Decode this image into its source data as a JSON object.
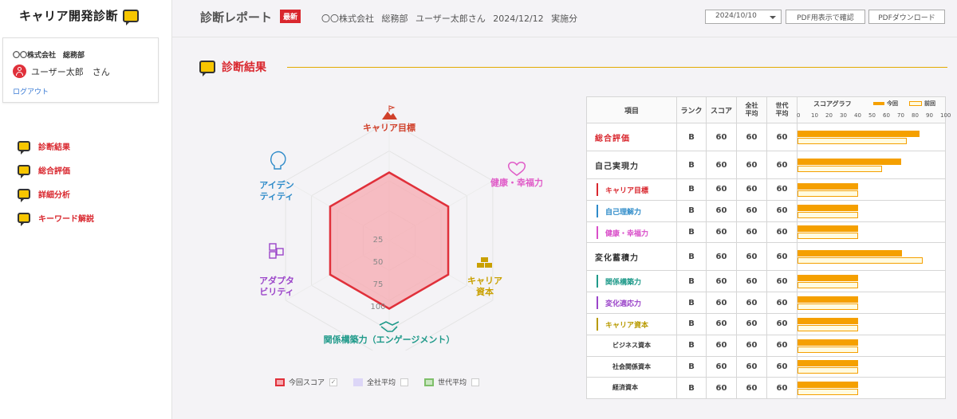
{
  "sidebar": {
    "logo": "キャリア開発診断",
    "user": {
      "company": "〇〇株式会社　総務部",
      "name": "ユーザー太郎　さん",
      "logout": "ログアウト"
    },
    "nav": [
      {
        "label": "診断結果"
      },
      {
        "label": "総合評価"
      },
      {
        "label": "詳細分析"
      },
      {
        "label": "キーワード解説"
      }
    ]
  },
  "header": {
    "title": "診断レポート",
    "badge": "最新",
    "info": "〇〇株式会社 総務部 ユーザー太郎さん 2024/12/12 実施分",
    "date_select": "2024/10/10",
    "btn_pdf_view": "PDF用表示で確認",
    "btn_pdf_download": "PDFダウンロード"
  },
  "section": {
    "title": "診断結果"
  },
  "radar": {
    "labels": [
      "キャリア目標",
      "健康・幸福力",
      "キャリア\n資本",
      "関係構築力（エンゲージメント）",
      "アダプタ\nビリティ",
      "アイデン\nティティ"
    ],
    "scale": [
      "25",
      "50",
      "75",
      "100"
    ],
    "values": [
      60,
      60,
      60,
      60,
      60,
      60
    ],
    "colors": {
      "score": "#e0303a",
      "fill": "#f7a9b0"
    }
  },
  "legend": [
    {
      "label": "今回スコア",
      "checked": "✓",
      "color": "#f7a9b0",
      "border": "#e0303a"
    },
    {
      "label": "全社平均",
      "checked": "",
      "color": "#dcd6f7",
      "border": "#dcd6f7"
    },
    {
      "label": "世代平均",
      "checked": "",
      "color": "#c9e6c0",
      "border": "#7fbf6a"
    }
  ],
  "table": {
    "headers": {
      "item": "項目",
      "rank": "ランク",
      "score": "スコア",
      "company_avg": "全社\n平均",
      "gen_avg": "世代\n平均",
      "graph": "スコアグラフ",
      "now": "今回",
      "prev": "前回"
    },
    "ticks": [
      "0",
      "10",
      "20",
      "30",
      "40",
      "50",
      "60",
      "70",
      "80",
      "90",
      "100"
    ],
    "rows": [
      {
        "label": "総合評価",
        "level": 0,
        "color": "#d9272e",
        "rank": "B",
        "score": "60",
        "company": "60",
        "gen": "60",
        "now": 85,
        "prev": 76
      },
      {
        "label": "自己実現力",
        "level": 0,
        "color": "#333",
        "rank": "B",
        "score": "60",
        "company": "60",
        "gen": "60",
        "now": 72,
        "prev": 59
      },
      {
        "label": "キャリア目標",
        "level": 1,
        "color": "#d9272e",
        "rank": "B",
        "score": "60",
        "company": "60",
        "gen": "60",
        "now": 42,
        "prev": 42
      },
      {
        "label": "自己理解力",
        "level": 1,
        "color": "#2e8bc9",
        "rank": "B",
        "score": "60",
        "company": "60",
        "gen": "60",
        "now": 42,
        "prev": 42
      },
      {
        "label": "健康・幸福力",
        "level": 1,
        "color": "#d94fc9",
        "rank": "B",
        "score": "60",
        "company": "60",
        "gen": "60",
        "now": 42,
        "prev": 42
      },
      {
        "label": "変化蓄積力",
        "level": 0,
        "color": "#333",
        "rank": "B",
        "score": "60",
        "company": "60",
        "gen": "60",
        "now": 73,
        "prev": 87
      },
      {
        "label": "関係構築力",
        "level": 1,
        "color": "#1f9a8a",
        "rank": "B",
        "score": "60",
        "company": "60",
        "gen": "60",
        "now": 42,
        "prev": 42
      },
      {
        "label": "変化適応力",
        "level": 1,
        "color": "#9b45c9",
        "rank": "B",
        "score": "60",
        "company": "60",
        "gen": "60",
        "now": 42,
        "prev": 42
      },
      {
        "label": "キャリア資本",
        "level": 1,
        "color": "#b89a00",
        "rank": "B",
        "score": "60",
        "company": "60",
        "gen": "60",
        "now": 42,
        "prev": 42
      },
      {
        "label": "ビジネス資本",
        "level": 2,
        "color": "#333",
        "rank": "B",
        "score": "60",
        "company": "60",
        "gen": "60",
        "now": 42,
        "prev": 42
      },
      {
        "label": "社会関係資本",
        "level": 2,
        "color": "#333",
        "rank": "B",
        "score": "60",
        "company": "60",
        "gen": "60",
        "now": 42,
        "prev": 42
      },
      {
        "label": "経済資本",
        "level": 2,
        "color": "#333",
        "rank": "B",
        "score": "60",
        "company": "60",
        "gen": "60",
        "now": 42,
        "prev": 42
      }
    ]
  }
}
